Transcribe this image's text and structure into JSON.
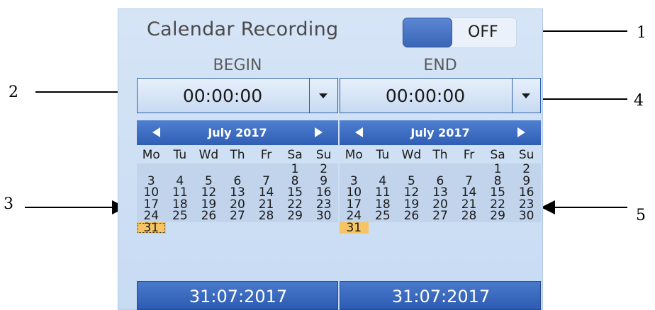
{
  "panel": {
    "title": "Calendar Recording",
    "toggle_state": "OFF"
  },
  "begin": {
    "label": "BEGIN",
    "time": "00:00:00",
    "month": "July 2017",
    "weekdays": [
      "Mo",
      "Tu",
      "Wd",
      "Th",
      "Fr",
      "Sa",
      "Su"
    ],
    "weeks": [
      [
        "",
        "",
        "",
        "",
        "",
        "1",
        "2"
      ],
      [
        "3",
        "4",
        "5",
        "6",
        "7",
        "8",
        "9"
      ],
      [
        "10",
        "11",
        "12",
        "13",
        "14",
        "15",
        "16"
      ],
      [
        "17",
        "18",
        "19",
        "20",
        "21",
        "22",
        "23"
      ],
      [
        "24",
        "25",
        "26",
        "27",
        "28",
        "29",
        "30"
      ],
      [
        "31",
        "",
        "",
        "",
        "",
        "",
        ""
      ]
    ],
    "selected_day": "31",
    "date": "31:07:2017"
  },
  "end": {
    "label": "END",
    "time": "00:00:00",
    "month": "July 2017",
    "weekdays": [
      "Mo",
      "Tu",
      "Wd",
      "Th",
      "Fr",
      "Sa",
      "Su"
    ],
    "weeks": [
      [
        "",
        "",
        "",
        "",
        "",
        "1",
        "2"
      ],
      [
        "3",
        "4",
        "5",
        "6",
        "7",
        "8",
        "9"
      ],
      [
        "10",
        "11",
        "12",
        "13",
        "14",
        "15",
        "16"
      ],
      [
        "17",
        "18",
        "19",
        "20",
        "21",
        "22",
        "23"
      ],
      [
        "24",
        "25",
        "26",
        "27",
        "28",
        "29",
        "30"
      ],
      [
        "31",
        "",
        "",
        "",
        "",
        "",
        ""
      ]
    ],
    "selected_day": "31",
    "date": "31:07:2017"
  },
  "annotations": {
    "n1": "1",
    "n2": "2",
    "n3": "3",
    "n4": "4",
    "n5": "5"
  },
  "colors": {
    "panel_bg": "#d6e5f6",
    "accent": "#2f5eb5",
    "selected": "#f7c463"
  }
}
